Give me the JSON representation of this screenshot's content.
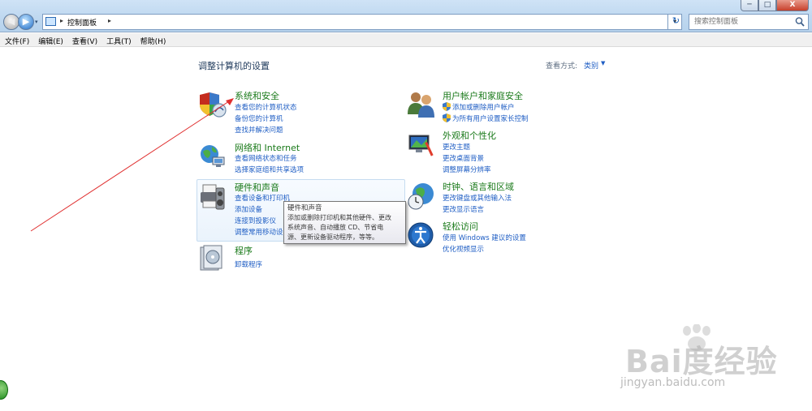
{
  "window": {
    "min_glyph": "─",
    "max_glyph": "□",
    "close_glyph": "X"
  },
  "address_bar": {
    "separator": "▸",
    "text": "控制面板",
    "separator2": "▸",
    "dropdown_glyph": "▾"
  },
  "search": {
    "placeholder": "搜索控制面板"
  },
  "nav": {
    "back_glyph": "◀",
    "forward_glyph": "▶",
    "history_glyph": "▾",
    "refresh_glyph": "↻"
  },
  "menu": [
    "文件(F)",
    "编辑(E)",
    "查看(V)",
    "工具(T)",
    "帮助(H)"
  ],
  "main": {
    "title": "调整计算机的设置",
    "view_by_label": "查看方式:",
    "view_by_value": "类别",
    "view_by_arrow": "▼"
  },
  "categories": {
    "system": {
      "title": "系统和安全",
      "links": [
        "查看您的计算机状态",
        "备份您的计算机",
        "查找并解决问题"
      ]
    },
    "network": {
      "title": "网络和 Internet",
      "links": [
        "查看网络状态和任务",
        "选择家庭组和共享选项"
      ]
    },
    "hardware": {
      "title": "硬件和声音",
      "links": [
        "查看设备和打印机",
        "添加设备",
        "连接到投影仪",
        "调整常用移动设"
      ]
    },
    "programs": {
      "title": "程序",
      "links": [
        "卸载程序"
      ]
    },
    "users": {
      "title": "用户帐户和家庭安全",
      "links": [
        "添加或删除用户帐户",
        "为所有用户设置家长控制"
      ]
    },
    "appearance": {
      "title": "外观和个性化",
      "links": [
        "更改主题",
        "更改桌面背景",
        "调整屏幕分辨率"
      ]
    },
    "clock": {
      "title": "时钟、语言和区域",
      "links": [
        "更改键盘或其他输入法",
        "更改显示语言"
      ]
    },
    "ease": {
      "title": "轻松访问",
      "links": [
        "使用 Windows 建议的设置",
        "优化视频显示"
      ]
    }
  },
  "tooltip": {
    "title": "硬件和声音",
    "lines": [
      "添加或删除打印机和其他硬件、更改",
      "系统声音、自动播放 CD、节省电",
      "源、更新设备驱动程序，等等。"
    ]
  },
  "watermark": {
    "logo": "Bai度经验",
    "sub": "jingyan.baidu.com"
  },
  "colors": {
    "category_title": "#1a7a1a",
    "link": "#1f5ec4",
    "annotation_arrow": "#e03030"
  }
}
